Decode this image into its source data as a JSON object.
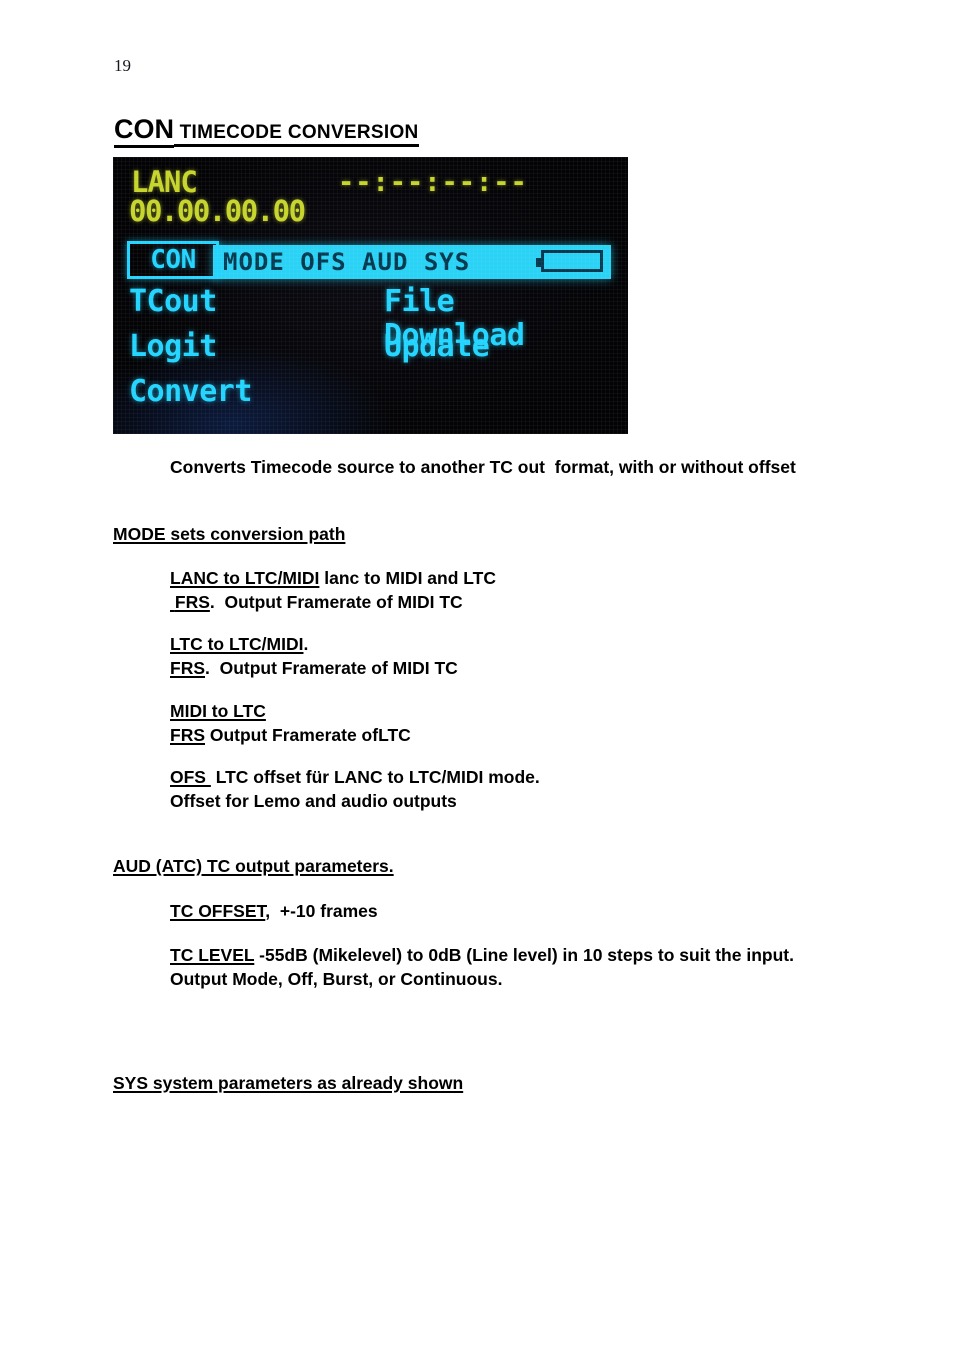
{
  "page": {
    "number": "19"
  },
  "heading": {
    "main": "CON",
    "sub": " TIMECODE CONVERSION"
  },
  "device_display": {
    "source_label": "LANC",
    "source_timecode": "00.00.00.00",
    "output_timecode": "--:--:--:--",
    "selected_item": "CON",
    "menu_bar_items": "MODE OFS AUD SYS",
    "battery_icon": "battery-icon",
    "menu_rows": [
      {
        "left": "TCout",
        "right": "File Download"
      },
      {
        "left": "Logit",
        "right": "Update"
      },
      {
        "left": "Convert",
        "right": ""
      }
    ],
    "colors": {
      "screen_background": "#050507",
      "source_text": "#c6d42b",
      "menu_text": "#22d5ff",
      "highlight_fill": "#2ad2f6",
      "highlight_text": "#04384f"
    }
  },
  "body": {
    "intro": "Converts Timecode source to another TC out  format, with or without offset",
    "mode_heading": "MODE sets conversion path",
    "lanc": {
      "title": "LANC to LTC/MIDI",
      "title_rest": " lanc to MIDI and LTC",
      "frs_title": " FRS",
      "frs_rest": ".  Output Framerate of MIDI TC"
    },
    "ltc": {
      "title": "LTC to LTC/MIDI",
      "title_rest": ".",
      "frs_title": "FRS",
      "frs_rest": ".  Output Framerate of MIDI TC"
    },
    "midi": {
      "title": "MIDI to LTC",
      "frs_title": "FRS",
      "frs_rest": " Output Framerate ofLTC"
    },
    "ofs": {
      "title": "OFS ",
      "title_rest": " LTC offset für LANC to LTC/MIDI mode.",
      "line2": "Offset for Lemo and audio outputs"
    },
    "aud_heading": "AUD (ATC) TC output parameters.",
    "tc_offset": {
      "title": "TC OFFSET",
      "rest": ",  +-10 frames"
    },
    "tc_level": {
      "title": "TC LEVEL",
      "rest": " -55dB (Mikelevel) to 0dB (Line level) in 10 steps to suit the input.",
      "line2": "Output Mode, Off, Burst, or Continuous."
    },
    "sys_heading": "SYS system parameters as already shown"
  }
}
